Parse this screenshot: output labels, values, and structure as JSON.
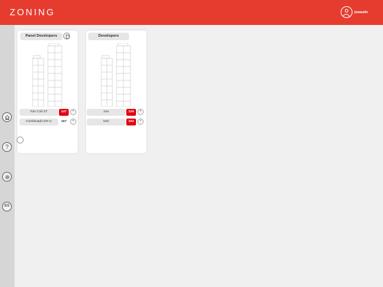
{
  "app": {
    "title": "ZONING",
    "username": "joeaudo"
  },
  "sidebar": {
    "lang_label": "ES"
  },
  "cards": [
    {
      "title": "Panel Developers",
      "rows": [
        {
          "label": "Fan Coil 2T",
          "count": "147",
          "highlight": true
        },
        {
          "label": "Combinado DX-C",
          "count": "167",
          "highlight": false
        }
      ]
    },
    {
      "title": "Developers",
      "rows": [
        {
          "label": "zoe",
          "count": "126",
          "highlight": true
        },
        {
          "label": "test",
          "count": "152",
          "highlight": true
        }
      ]
    }
  ],
  "colors": {
    "brand": "#e63c2f",
    "badge": "#e30613"
  }
}
